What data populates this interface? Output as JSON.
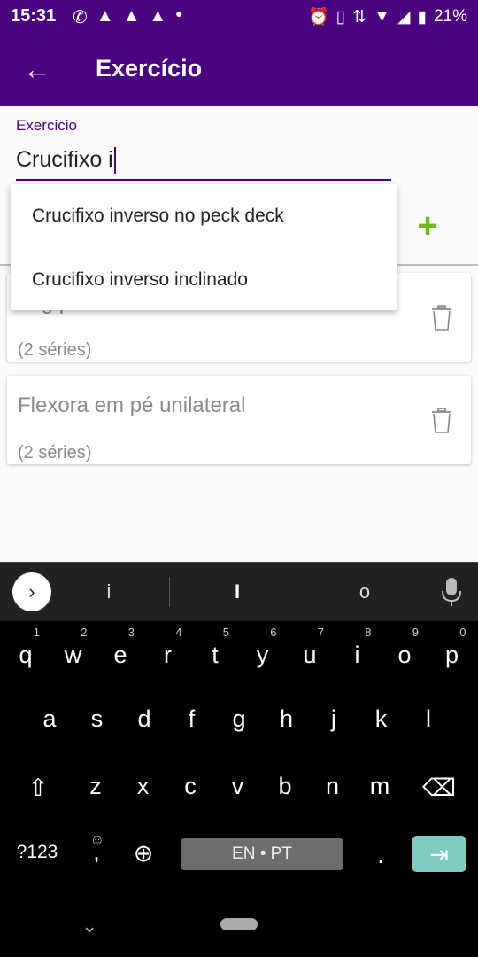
{
  "status_bar": {
    "time": "15:31",
    "battery": "21%"
  },
  "app_bar": {
    "title": "Exercício"
  },
  "form": {
    "label": "Exercicio",
    "value": "Crucifixo i"
  },
  "dropdown": {
    "items": [
      "Crucifixo inverso no peck deck",
      "Crucifixo inverso inclinado"
    ]
  },
  "cards": [
    {
      "title": "Leg press",
      "subtitle": "(2 séries)"
    },
    {
      "title": "Flexora em pé unilateral",
      "subtitle": "(2 séries)"
    }
  ],
  "keyboard": {
    "suggestions": [
      "i",
      "I",
      "o"
    ],
    "row1": [
      "q",
      "w",
      "e",
      "r",
      "t",
      "y",
      "u",
      "i",
      "o",
      "p"
    ],
    "row1_numbers": [
      "1",
      "2",
      "3",
      "4",
      "5",
      "6",
      "7",
      "8",
      "9",
      "0"
    ],
    "row2": [
      "a",
      "s",
      "d",
      "f",
      "g",
      "h",
      "j",
      "k",
      "l"
    ],
    "row3": [
      "z",
      "x",
      "c",
      "v",
      "b",
      "n",
      "m"
    ],
    "symbols_key": "?123",
    "comma_key": ",",
    "period_key": ".",
    "space_label": "EN • PT"
  },
  "colors": {
    "primary": "#4a0480",
    "accent": "#74b816"
  }
}
